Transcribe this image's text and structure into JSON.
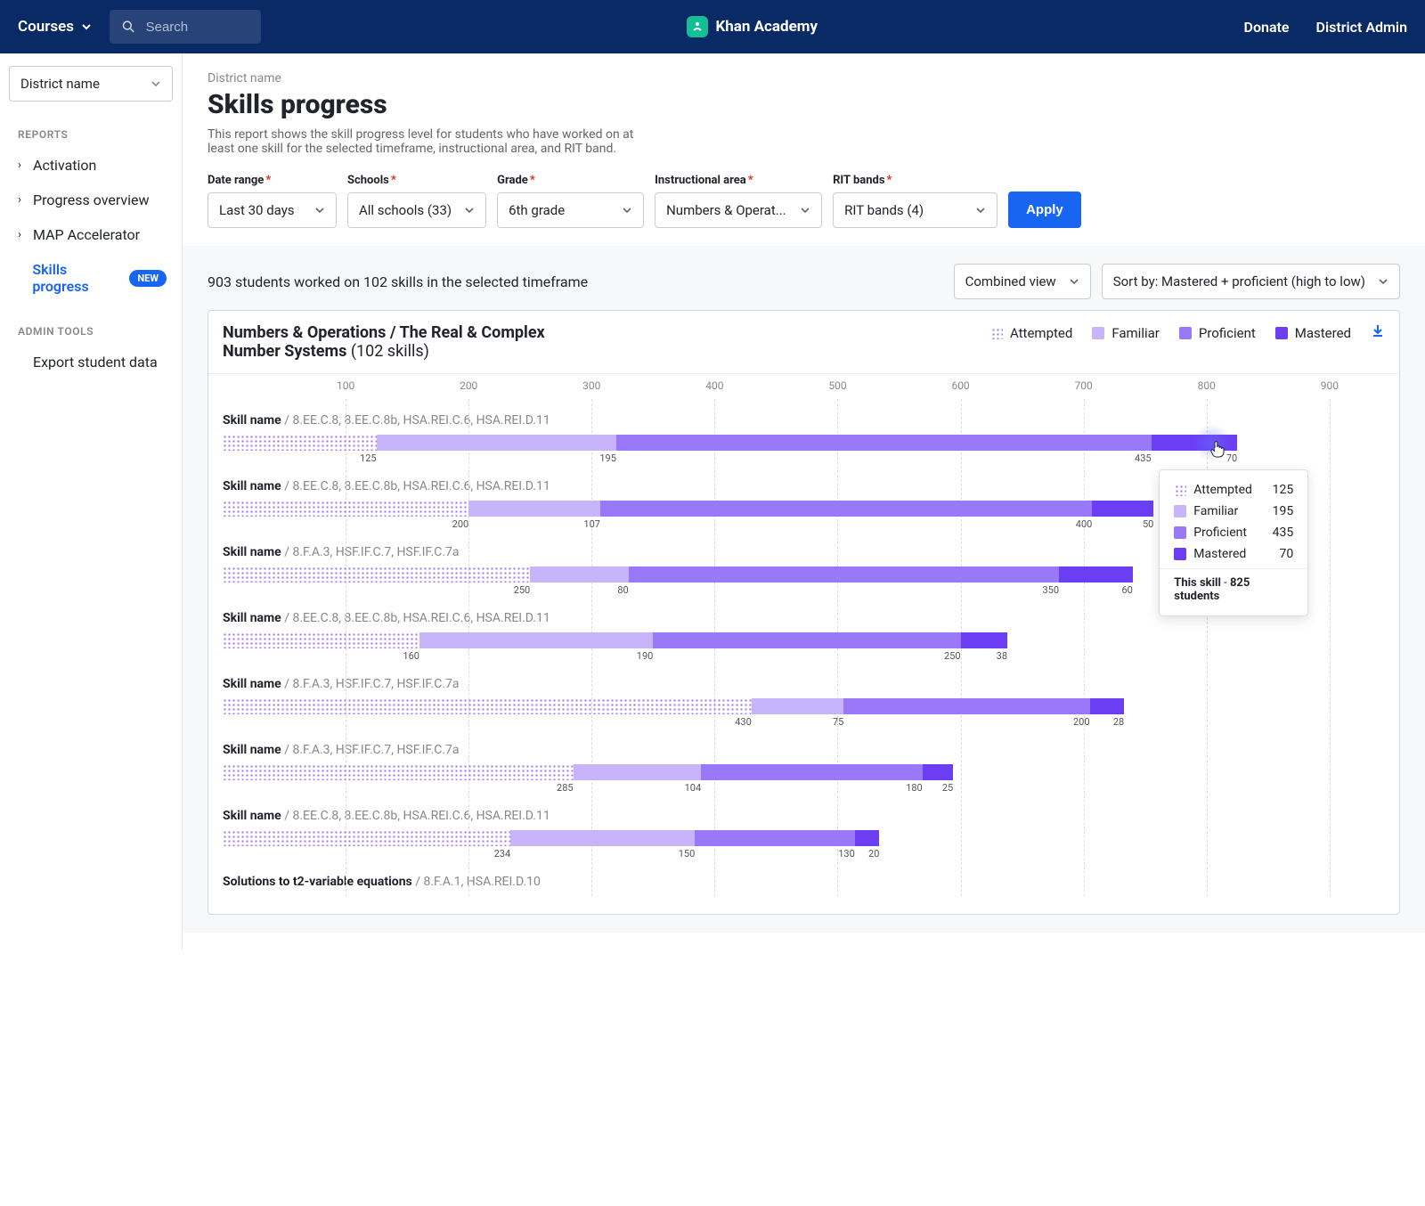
{
  "header": {
    "courses": "Courses",
    "search_placeholder": "Search",
    "brand": "Khan Academy",
    "donate": "Donate",
    "district_admin": "District Admin"
  },
  "sidebar": {
    "district_select": "District name",
    "reports_label": "REPORTS",
    "items": [
      {
        "label": "Activation",
        "has_chev": true
      },
      {
        "label": "Progress overview",
        "has_chev": true
      },
      {
        "label": "MAP Accelerator",
        "has_chev": true
      },
      {
        "label": "Skills progress",
        "has_chev": false,
        "active": true,
        "badge": "NEW"
      }
    ],
    "admin_tools_label": "ADMIN TOOLS",
    "admin_items": [
      {
        "label": "Export student data"
      }
    ]
  },
  "main": {
    "breadcrumb": "District name",
    "title": "Skills progress",
    "description": "This report shows the skill progress level for students who have worked on at least one skill for the selected timeframe, instructional area, and RIT band."
  },
  "filters": {
    "date_range": {
      "label": "Date range",
      "value": "Last 30 days"
    },
    "schools": {
      "label": "Schools",
      "value": "All schools (33)"
    },
    "grade": {
      "label": "Grade",
      "value": "6th grade"
    },
    "instructional_area": {
      "label": "Instructional area",
      "value": "Numbers & Operat..."
    },
    "rit_bands": {
      "label": "RIT bands",
      "value": "RIT bands (4)"
    },
    "apply": "Apply"
  },
  "toolbar": {
    "students_text": "903 students worked on 102 skills in the selected timeframe",
    "view": "Combined view",
    "sort": "Sort by: Mastered + proficient (high to low)"
  },
  "chart_header": {
    "title_main": "Numbers & Operations / The Real & Complex Number Systems",
    "title_suffix": "(102 skills)",
    "legend": {
      "attempted": "Attempted",
      "familiar": "Familiar",
      "proficient": "Proficient",
      "mastered": "Mastered"
    }
  },
  "tooltip": {
    "rows": [
      {
        "label": "Attempted",
        "value": 125
      },
      {
        "label": "Familiar",
        "value": 195
      },
      {
        "label": "Proficient",
        "value": 435
      },
      {
        "label": "Mastered",
        "value": 70
      }
    ],
    "total_prefix": "This skill",
    "total_sep": " - ",
    "total_suffix": "825 students"
  },
  "chart_data": {
    "type": "bar",
    "xlim": [
      0,
      945
    ],
    "ticks": [
      100,
      200,
      300,
      400,
      500,
      600,
      700,
      800,
      900
    ],
    "series_names": [
      "Attempted",
      "Familiar",
      "Proficient",
      "Mastered"
    ],
    "skills": [
      {
        "name": "Skill name",
        "codes": "8.EE.C.8, 8.EE.C.8b, HSA.REI.C.6, HSA.REI.D.11",
        "values": [
          125,
          195,
          435,
          70
        ]
      },
      {
        "name": "Skill name",
        "codes": "8.EE.C.8, 8.EE.C.8b, HSA.REI.C.6, HSA.REI.D.11",
        "values": [
          200,
          107,
          400,
          50
        ]
      },
      {
        "name": "Skill name",
        "codes": "8.F.A.3, HSF.IF.C.7, HSF.IF.C.7a",
        "values": [
          250,
          80,
          350,
          60
        ]
      },
      {
        "name": "Skill name",
        "codes": "8.EE.C.8, 8.EE.C.8b, HSA.REI.C.6, HSA.REI.D.11",
        "values": [
          160,
          190,
          250,
          38
        ]
      },
      {
        "name": "Skill name",
        "codes": "8.F.A.3, HSF.IF.C.7, HSF.IF.C.7a",
        "values": [
          430,
          75,
          200,
          28
        ]
      },
      {
        "name": "Skill name",
        "codes": "8.F.A.3, HSF.IF.C.7, HSF.IF.C.7a",
        "values": [
          285,
          104,
          180,
          25
        ]
      },
      {
        "name": "Skill name",
        "codes": "8.EE.C.8, 8.EE.C.8b, HSA.REI.C.6, HSA.REI.D.11",
        "values": [
          234,
          150,
          130,
          20
        ]
      },
      {
        "name": "Solutions to t2-variable equations",
        "codes": "8.F.A.1, HSA.REI.D.10",
        "values": null
      }
    ]
  },
  "colors": {
    "attempted_pattern": "#9d73ff",
    "familiar": "#c7b4fb",
    "proficient": "#9979f7",
    "mastered": "#6c3ef3",
    "accent": "#1865f2"
  }
}
